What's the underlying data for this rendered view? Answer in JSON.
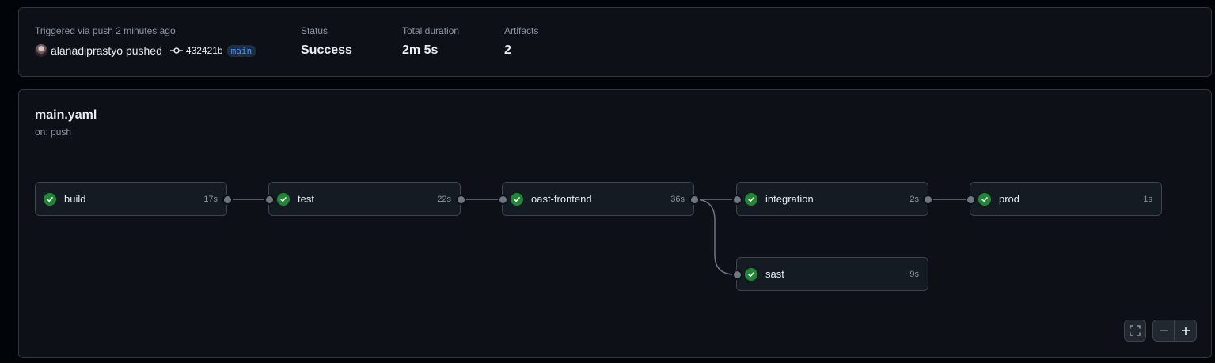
{
  "summary": {
    "triggered_label": "Triggered via push 2 minutes ago",
    "actor_text": "alanadiprastyo pushed",
    "commit_sha": "432421b",
    "branch": "main",
    "status_label": "Status",
    "status_value": "Success",
    "duration_label": "Total duration",
    "duration_value": "2m 5s",
    "artifacts_label": "Artifacts",
    "artifacts_value": "2"
  },
  "workflow": {
    "name": "main.yaml",
    "trigger": "on: push",
    "jobs": [
      {
        "name": "build",
        "duration": "17s",
        "status": "success"
      },
      {
        "name": "test",
        "duration": "22s",
        "status": "success"
      },
      {
        "name": "oast-frontend",
        "duration": "36s",
        "status": "success"
      },
      {
        "name": "integration",
        "duration": "2s",
        "status": "success"
      },
      {
        "name": "prod",
        "duration": "1s",
        "status": "success"
      },
      {
        "name": "sast",
        "duration": "9s",
        "status": "success"
      }
    ]
  },
  "controls": {
    "fullscreen_icon": "fullscreen-icon",
    "zoom_out_icon": "minus-icon",
    "zoom_in_icon": "plus-icon"
  },
  "colors": {
    "success": "#238636",
    "branch": "#4493f8"
  }
}
